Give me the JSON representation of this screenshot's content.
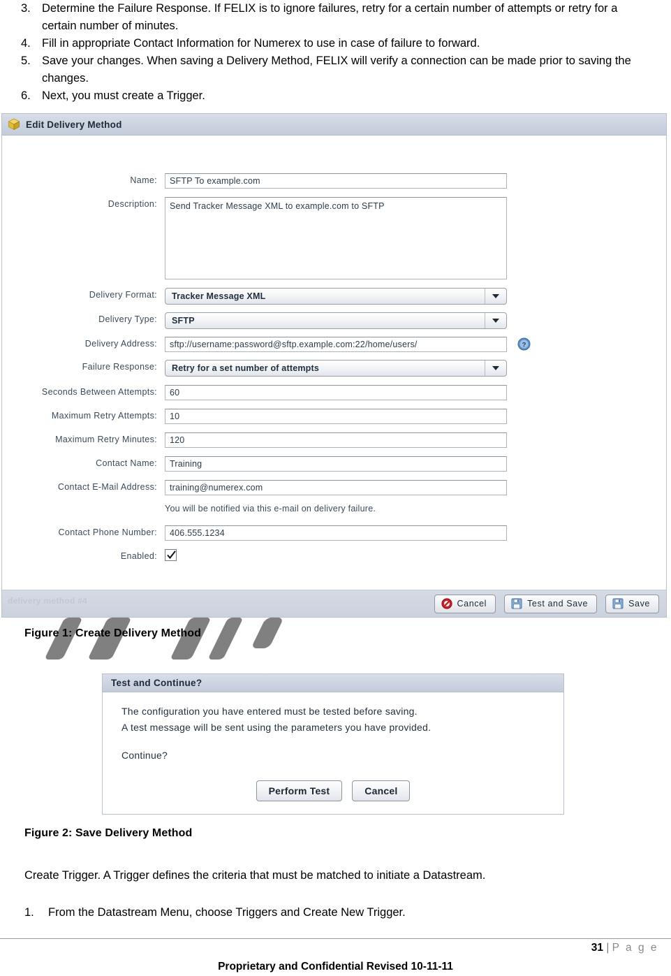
{
  "steps": [
    {
      "num": "3.",
      "text": "Determine the Failure Response.  If FELIX is to ignore failures, retry for a certain number of attempts or retry for a certain number of minutes."
    },
    {
      "num": "4.",
      "text": "Fill in appropriate Contact Information for Numerex to use in case of failure to forward."
    },
    {
      "num": "5.",
      "text": "Save your changes.  When saving a Delivery Method, FELIX will verify a connection can be made prior to saving the changes."
    },
    {
      "num": "6.",
      "text": "Next, you must create a Trigger."
    }
  ],
  "dialog1": {
    "title": "Edit Delivery Method",
    "icon": "package-icon",
    "ghost_text": "delivery method #4",
    "fields": {
      "name_label": "Name:",
      "name_value": "SFTP To example.com",
      "description_label": "Description:",
      "description_value": "Send Tracker Message XML to example.com to SFTP",
      "delivery_format_label": "Delivery Format:",
      "delivery_format_value": "Tracker Message XML",
      "delivery_type_label": "Delivery Type:",
      "delivery_type_value": "SFTP",
      "delivery_address_label": "Delivery Address:",
      "delivery_address_value": "sftp://username:password@sftp.example.com:22/home/users/",
      "failure_response_label": "Failure Response:",
      "failure_response_value": "Retry for a set number of attempts",
      "seconds_between_label": "Seconds Between Attempts:",
      "seconds_between_value": "60",
      "max_retry_attempts_label": "Maximum Retry Attempts:",
      "max_retry_attempts_value": "10",
      "max_retry_minutes_label": "Maximum Retry Minutes:",
      "max_retry_minutes_value": "120",
      "contact_name_label": "Contact Name:",
      "contact_name_value": "Training",
      "contact_email_label": "Contact E-Mail Address:",
      "contact_email_value": "training@numerex.com",
      "contact_email_hint": "You will be notified via this e-mail on delivery failure.",
      "contact_phone_label": "Contact Phone Number:",
      "contact_phone_value": "406.555.1234",
      "enabled_label": "Enabled:",
      "enabled_checked": true
    },
    "buttons": {
      "cancel": "Cancel",
      "test_and_save": "Test and Save",
      "save": "Save"
    }
  },
  "caption1": "Figure 1: Create Delivery Method",
  "dialog2": {
    "title": "Test and Continue?",
    "line1": "The configuration you have entered must be tested before saving.",
    "line2": "A test message will be sent using the parameters you have provided.",
    "continue": "Continue?",
    "buttons": {
      "perform_test": "Perform Test",
      "cancel": "Cancel"
    }
  },
  "caption2": "Figure 2: Save Delivery Method",
  "body_paragraph": "Create Trigger.  A Trigger defines the criteria that must be matched to initiate a Datastream.",
  "trigger_step": {
    "num": "1.",
    "text": "From the Datastream Menu, choose Triggers and Create New Trigger."
  },
  "footer": {
    "page_number": "31",
    "page_sep": "|",
    "page_word": "P a g e",
    "notice": "Proprietary and Confidential Revised 10-11-11"
  }
}
